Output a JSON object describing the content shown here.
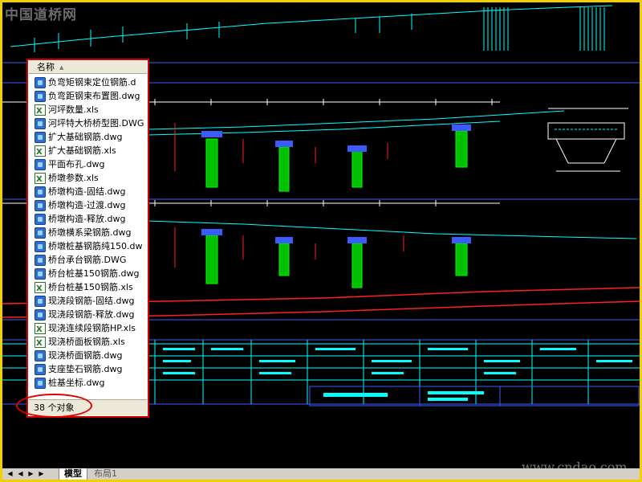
{
  "watermark_top": "中国道桥网",
  "watermark_bottom": "www.cndao.com",
  "file_panel": {
    "column_header": "名称",
    "files": [
      {
        "name": "负弯矩钢束定位钢筋.d",
        "type": "dwg"
      },
      {
        "name": "负弯距钢束布置图.dwg",
        "type": "dwg"
      },
      {
        "name": "河坪数量.xls",
        "type": "xls"
      },
      {
        "name": "河坪特大桥桥型图.DWG",
        "type": "dwg"
      },
      {
        "name": "扩大基础钢筋.dwg",
        "type": "dwg"
      },
      {
        "name": "扩大基础钢筋.xls",
        "type": "xls"
      },
      {
        "name": "平面布孔.dwg",
        "type": "dwg"
      },
      {
        "name": "桥墩参数.xls",
        "type": "xls"
      },
      {
        "name": "桥墩构造-固结.dwg",
        "type": "dwg"
      },
      {
        "name": "桥墩构造-过渡.dwg",
        "type": "dwg"
      },
      {
        "name": "桥墩构造-释放.dwg",
        "type": "dwg"
      },
      {
        "name": "桥墩横系梁钢筋.dwg",
        "type": "dwg"
      },
      {
        "name": "桥墩桩基钢筋纯150.dw",
        "type": "dwg"
      },
      {
        "name": "桥台承台钢筋.DWG",
        "type": "dwg"
      },
      {
        "name": "桥台桩基150钢筋.dwg",
        "type": "dwg"
      },
      {
        "name": "桥台桩基150钢筋.xls",
        "type": "xls"
      },
      {
        "name": "现浇段钢筋-固结.dwg",
        "type": "dwg"
      },
      {
        "name": "现浇段钢筋-释放.dwg",
        "type": "dwg"
      },
      {
        "name": "现浇连续段钢筋HP.xls",
        "type": "xls"
      },
      {
        "name": "现浇桥面板钢筋.xls",
        "type": "xls"
      },
      {
        "name": "现浇桥面钢筋.dwg",
        "type": "dwg"
      },
      {
        "name": "支座垫石钢筋.dwg",
        "type": "dwg"
      },
      {
        "name": "桩基坐标.dwg",
        "type": "dwg"
      }
    ],
    "status": "38 个对象"
  },
  "layout_tabs": {
    "model": "模型",
    "layout1": "布局1"
  },
  "colors": {
    "drawing_bg": "#000000",
    "frame": "#f2d000",
    "highlight": "#d40000",
    "cad_cyan": "#00ffff",
    "cad_green": "#00ff00",
    "cad_blue": "#3b5bff",
    "cad_red": "#ff2020"
  }
}
